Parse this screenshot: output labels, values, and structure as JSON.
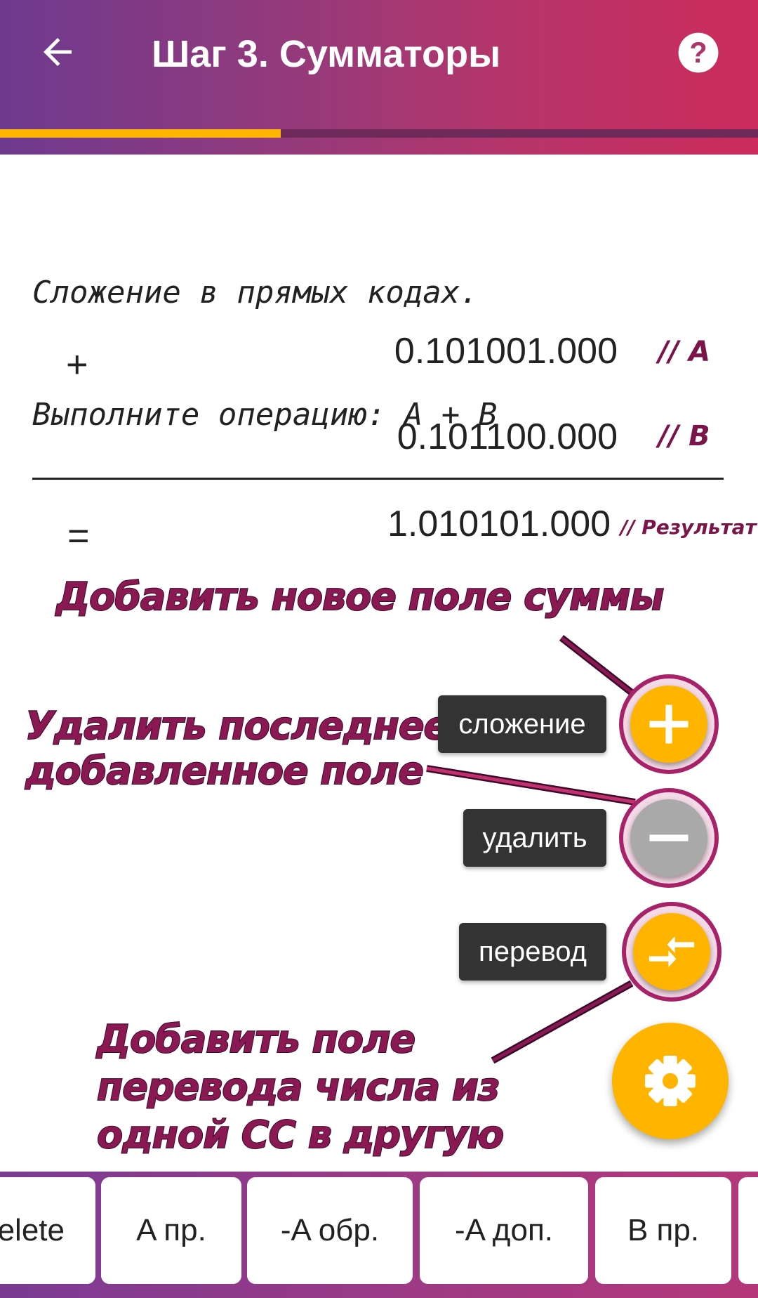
{
  "appbar": {
    "title": "Шаг 3. Сумматоры",
    "back_icon": "arrow-left-icon",
    "help_icon": "help-circle-icon",
    "progress_fraction": 0.37,
    "colors": {
      "gradient_start": "#6e3a8f",
      "gradient_end": "#cc2b5c",
      "progress": "#ffb400"
    }
  },
  "task": {
    "line1": "Сложение в прямых кодах.",
    "line2": "Выполните операцию: A + B"
  },
  "calc": {
    "plus_sign": "+",
    "equals_sign": "=",
    "a_value": "0.101001.000",
    "a_comment": "// A",
    "b_value": "0.101100.000",
    "b_comment": "// B",
    "result_value": "1.010101.000",
    "result_comment": "// Результат"
  },
  "hints": {
    "add_sum": "Добавить новое поле суммы",
    "delete_last_line1": "Удалить последнее",
    "delete_last_line2": "добавленное поле",
    "conversion_line1": "Добавить поле",
    "conversion_line2": "перевода числа из",
    "conversion_line3": "одной СС в другую"
  },
  "fab_menu": {
    "add_label": "сложение",
    "delete_label": "удалить",
    "convert_label": "перевод",
    "add_icon": "plus-icon",
    "delete_icon": "minus-icon",
    "convert_icon": "arrows-compress-icon",
    "main_icon": "gear-icon",
    "colors": {
      "accent": "#ffb400",
      "disabled": "#a9a9a9",
      "chip": "#333333"
    }
  },
  "keys": [
    "elete",
    "A пр.",
    "-A обр.",
    "-A доп.",
    "B пр.",
    ""
  ]
}
